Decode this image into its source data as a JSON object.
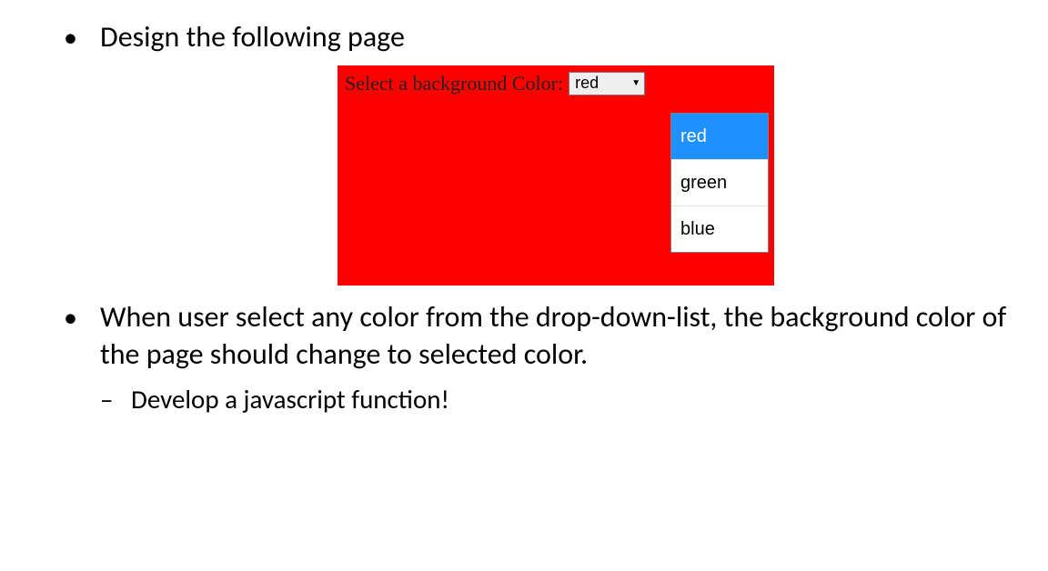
{
  "bullets": {
    "item1": "Design the following page",
    "item2": "When user select any color from the drop-down-list, the background color of the page should change to selected color.",
    "sub1": "Develop a javascript function!"
  },
  "embedded": {
    "label": "Select a background Color:",
    "selected": "red",
    "options": {
      "o1": "red",
      "o2": "green",
      "o3": "blue"
    },
    "bg_color": "#ff0000",
    "highlight_color": "#1e90ff"
  }
}
